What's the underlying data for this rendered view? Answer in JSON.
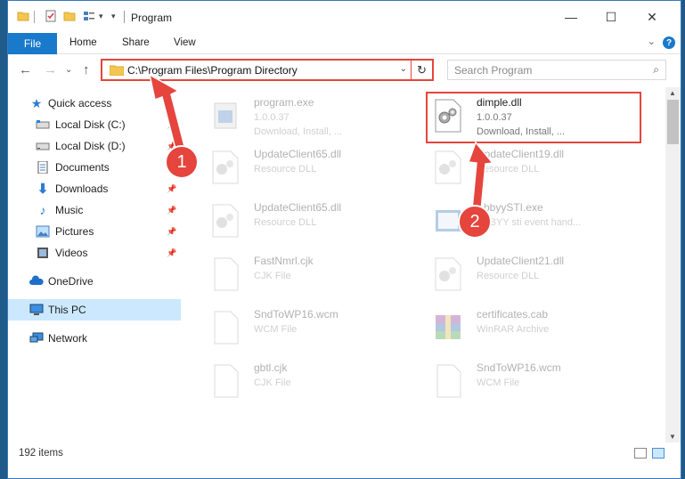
{
  "window": {
    "title": "Program",
    "controls": {
      "minimize": "—",
      "maximize": "☐",
      "close": "✕"
    }
  },
  "ribbon": {
    "file_tab": "File",
    "tabs": [
      "Home",
      "Share",
      "View"
    ],
    "help": "?",
    "collapse": "⌄"
  },
  "navbar": {
    "back": "←",
    "forward": "→",
    "recent": "⌄",
    "up": "↑",
    "address": "C:\\Program Files\\Program Directory",
    "address_dropdown": "⌄",
    "refresh": "↻",
    "search_placeholder": "Search Program",
    "search_icon": "⌕"
  },
  "sidebar": {
    "items": [
      {
        "label": "Quick access",
        "icon": "star-icon",
        "pinned": false,
        "selected": false
      },
      {
        "label": "Local Disk (C:)",
        "icon": "drive-icon",
        "pinned": true,
        "selected": false
      },
      {
        "label": "Local Disk (D:)",
        "icon": "drive-icon",
        "pinned": true,
        "selected": false
      },
      {
        "label": "Documents",
        "icon": "documents-icon",
        "pinned": true,
        "selected": false
      },
      {
        "label": "Downloads",
        "icon": "downloads-icon",
        "pinned": true,
        "selected": false
      },
      {
        "label": "Music",
        "icon": "music-icon",
        "pinned": true,
        "selected": false
      },
      {
        "label": "Pictures",
        "icon": "pictures-icon",
        "pinned": true,
        "selected": false
      },
      {
        "label": "Videos",
        "icon": "videos-icon",
        "pinned": true,
        "selected": false
      },
      {
        "label": "OneDrive",
        "icon": "cloud-icon",
        "pinned": false,
        "selected": false
      },
      {
        "label": "This PC",
        "icon": "computer-icon",
        "pinned": false,
        "selected": true
      },
      {
        "label": "Network",
        "icon": "network-icon",
        "pinned": false,
        "selected": false
      }
    ],
    "pin_glyph": "📌"
  },
  "files": [
    {
      "name": "program.exe",
      "type": "1.0.0.37",
      "desc": "Download, Install, ...",
      "icon": "exe-icon",
      "faded": true
    },
    {
      "name": "dimple.dll",
      "type": "1.0.0.37",
      "desc": "Download, Install, ...",
      "icon": "dll-icon",
      "faded": false
    },
    {
      "name": "UpdateClient65.dll",
      "type": "Resource DLL",
      "desc": "",
      "icon": "dll-icon",
      "faded": true
    },
    {
      "name": "UpdateClient19.dll",
      "type": "Resource DLL",
      "desc": "",
      "icon": "dll-icon",
      "faded": true
    },
    {
      "name": "UpdateClient65.dll",
      "type": "Resource DLL",
      "desc": "",
      "icon": "dll-icon",
      "faded": true
    },
    {
      "name": "AbbyySTI.exe",
      "type": "ABBYY sti event hand...",
      "desc": "",
      "icon": "app-icon",
      "faded": true
    },
    {
      "name": "FastNmrl.cjk",
      "type": "CJK File",
      "desc": "",
      "icon": "blank-file-icon",
      "faded": true
    },
    {
      "name": "UpdateClient21.dll",
      "type": "Resource DLL",
      "desc": "",
      "icon": "dll-icon",
      "faded": true
    },
    {
      "name": "SndToWP16.wcm",
      "type": "WCM File",
      "desc": "",
      "icon": "blank-file-icon",
      "faded": true
    },
    {
      "name": "certificates.cab",
      "type": "WinRAR Archive",
      "desc": "",
      "icon": "archive-icon",
      "faded": true
    },
    {
      "name": "gbtl.cjk",
      "type": "CJK File",
      "desc": "",
      "icon": "blank-file-icon",
      "faded": true
    },
    {
      "name": "SndToWP16.wcm",
      "type": "WCM File",
      "desc": "",
      "icon": "blank-file-icon",
      "faded": true
    }
  ],
  "status": {
    "item_count": "192 items"
  },
  "annotations": {
    "badge1": "1",
    "badge2": "2"
  },
  "colors": {
    "accent": "#1979ca",
    "highlight": "#e5453d",
    "selected": "#cce8ff"
  }
}
